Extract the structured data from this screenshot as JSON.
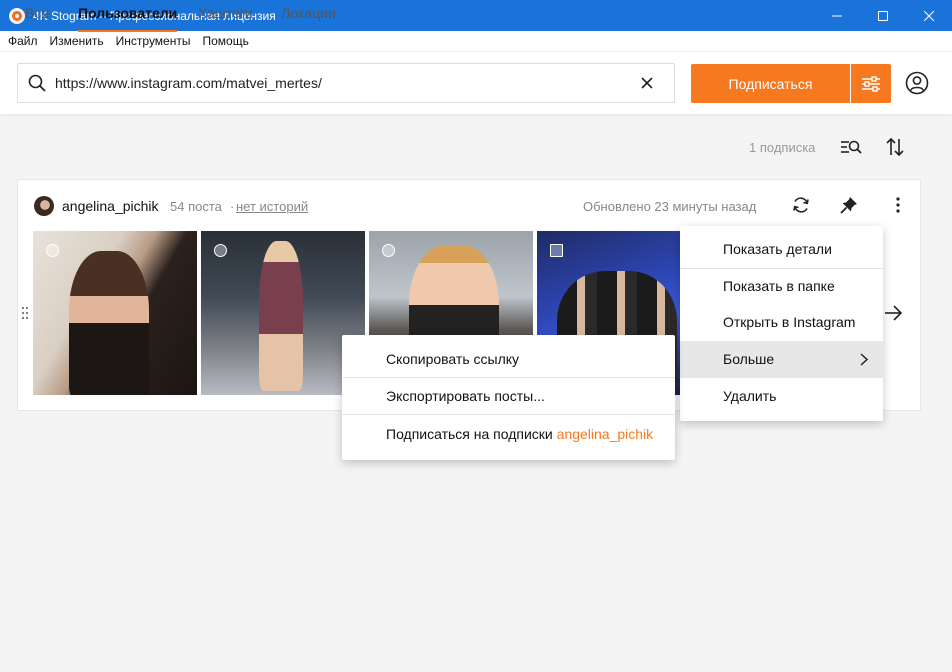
{
  "window": {
    "title": "4K Stogram – Профессиональная лицензия"
  },
  "menubar": {
    "items": [
      {
        "label": "Файл"
      },
      {
        "label": "Изменить"
      },
      {
        "label": "Инструменты"
      },
      {
        "label": "Помощь"
      }
    ]
  },
  "search": {
    "value": "https://www.instagram.com/matvei_mertes/",
    "subscribe_label": "Подписаться"
  },
  "tabs": [
    {
      "label": "Все",
      "active": false
    },
    {
      "label": "Пользователи",
      "active": true
    },
    {
      "label": "Хэштеги",
      "active": false
    },
    {
      "label": "Локации",
      "active": false
    }
  ],
  "subscriptions_count": "1 подписка",
  "subscription": {
    "username": "angelina_pichik",
    "posts": "54 поста",
    "separator": "·",
    "stories": "нет историй",
    "updated": "Обновлено 23 минуты назад"
  },
  "context_menu": {
    "items": [
      {
        "label": "Показать детали"
      },
      {
        "label": "Показать в папке"
      },
      {
        "label": "Открыть в Instagram"
      },
      {
        "label": "Больше",
        "highlighted": true,
        "has_submenu": true
      },
      {
        "label": "Удалить"
      }
    ]
  },
  "submenu": {
    "copy_link": "Скопировать ссылку",
    "export_posts": "Экспортировать посты...",
    "subscribe_prefix": "Подписаться на подписки",
    "subscribe_user": "angelina_pichik"
  },
  "colors": {
    "accent": "#f7791f",
    "titlebar": "#1a73d9"
  },
  "icons": {
    "search": "search-icon",
    "clear": "close-icon",
    "settings": "sliders-icon",
    "account": "account-icon",
    "filter": "filter-search-icon",
    "sort": "sort-icon",
    "refresh": "refresh-icon",
    "pin": "pin-icon",
    "more": "more-vertical-icon",
    "next": "arrow-right-icon"
  }
}
